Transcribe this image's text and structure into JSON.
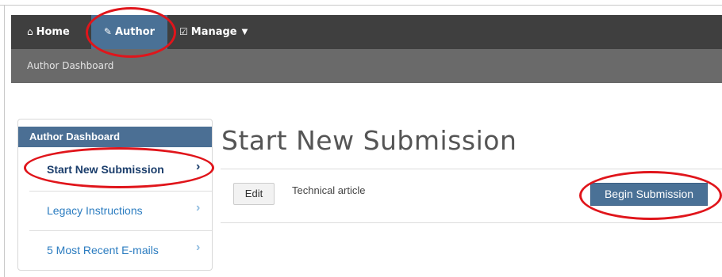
{
  "nav": {
    "home_icon": "home-icon",
    "home_label": "Home",
    "author_icon": "pencil-icon",
    "author_label": "Author",
    "manage_icon": "checkbox-icon",
    "manage_label": "Manage",
    "active": "Author"
  },
  "subnav": {
    "link": "Author Dashboard"
  },
  "sidebar": {
    "header": "Author Dashboard",
    "items": [
      {
        "label": "Start New Submission",
        "active": true
      },
      {
        "label": "Legacy Instructions",
        "active": false
      },
      {
        "label": "5 Most Recent E-mails",
        "active": false
      }
    ]
  },
  "main": {
    "title": "Start New Submission",
    "edit_label": "Edit",
    "article_type": "Technical article",
    "begin_label": "Begin Submission"
  },
  "colors": {
    "nav_bg": "#3f3f3f",
    "subnav_bg": "#6a6a6a",
    "accent": "#4a7196",
    "annotation": "#e0151b"
  }
}
